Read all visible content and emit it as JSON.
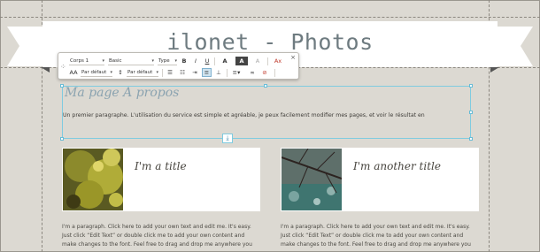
{
  "site": {
    "title": "ilonet - Photos"
  },
  "toolbar": {
    "font_style": "Corps 1",
    "font_family": "Basic",
    "font_size": "Type",
    "bold": "B",
    "italic": "I",
    "underline": "U",
    "font_color": "A",
    "highlight_color": "A",
    "clear_format": "A",
    "remove_format": "Ax",
    "letter_spacing": "Par défaut",
    "line_height": "Par défaut",
    "close": "×",
    "grip": "⁘"
  },
  "editor": {
    "heading": "Ma page A propos",
    "paragraph": "Un premier paragraphe. L'utilisation du service est simple et agréable, je peux facilement modifier mes pages, et voir le résultat en"
  },
  "cards": [
    {
      "title": "I'm a title",
      "text_lines": [
        "I'm a paragraph. Click here to add your own text and edit me. It's easy.",
        "Just click “Edit Text” or double click me to add your own content and",
        "make changes to the font. Feel free to drag and drop me anywhere you"
      ]
    },
    {
      "title": "I'm another title",
      "text_lines": [
        "I'm a paragraph. Click here to add your own text and edit me. It's easy.",
        "Just click “Edit Text” or double click me to add your own content and",
        "make changes to the font. Feel free to drag and drop me anywhere you"
      ]
    }
  ],
  "colors": {
    "background": "#dcd9d2",
    "selection": "#7fcbe0",
    "title": "#6e7b80",
    "heading": "#8ba3b0"
  }
}
